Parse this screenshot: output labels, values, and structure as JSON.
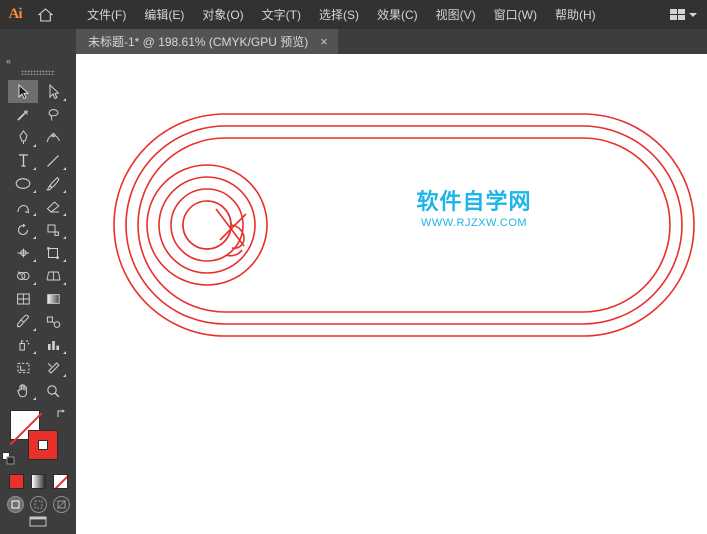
{
  "app": {
    "name": "Adobe Illustrator",
    "logo_text": "Ai",
    "home_icon": "home-icon"
  },
  "menubar": {
    "items": [
      {
        "label": "文件(F)",
        "name": "menu-file"
      },
      {
        "label": "编辑(E)",
        "name": "menu-edit"
      },
      {
        "label": "对象(O)",
        "name": "menu-object"
      },
      {
        "label": "文字(T)",
        "name": "menu-type"
      },
      {
        "label": "选择(S)",
        "name": "menu-select"
      },
      {
        "label": "效果(C)",
        "name": "menu-effect"
      },
      {
        "label": "视图(V)",
        "name": "menu-view"
      },
      {
        "label": "窗口(W)",
        "name": "menu-window"
      },
      {
        "label": "帮助(H)",
        "name": "menu-help"
      }
    ],
    "arrange_icon": "grid-arrange-icon",
    "arrange_caret": "chevron-down-icon"
  },
  "tabs": [
    {
      "title": "未标题-1* @ 198.61% (CMYK/GPU 预览)",
      "close_label": "×",
      "active": true
    }
  ],
  "toolbar": {
    "collapse_label": "«",
    "tools": [
      {
        "name": "selection-tool",
        "label": "选择工具",
        "selected": true
      },
      {
        "name": "direct-selection-tool",
        "label": "直接选择工具",
        "selected": false
      },
      {
        "name": "magic-wand-tool",
        "label": "魔棒工具",
        "selected": false
      },
      {
        "name": "lasso-tool",
        "label": "套索工具",
        "selected": false
      },
      {
        "name": "pen-tool",
        "label": "钢笔工具",
        "selected": false
      },
      {
        "name": "curvature-tool",
        "label": "曲率工具",
        "selected": false
      },
      {
        "name": "type-tool",
        "label": "文字工具",
        "selected": false
      },
      {
        "name": "line-segment-tool",
        "label": "直线段工具",
        "selected": false
      },
      {
        "name": "ellipse-tool",
        "label": "椭圆工具",
        "selected": false
      },
      {
        "name": "paintbrush-tool",
        "label": "画笔工具",
        "selected": false
      },
      {
        "name": "shaper-tool",
        "label": "Shaper 工具",
        "selected": false
      },
      {
        "name": "eraser-tool",
        "label": "橡皮擦工具",
        "selected": false
      },
      {
        "name": "rotate-tool",
        "label": "旋转工具",
        "selected": false
      },
      {
        "name": "scale-tool",
        "label": "比例缩放工具",
        "selected": false
      },
      {
        "name": "width-tool",
        "label": "宽度工具",
        "selected": false
      },
      {
        "name": "free-transform-tool",
        "label": "自由变换工具",
        "selected": false
      },
      {
        "name": "shape-builder-tool",
        "label": "形状生成器工具",
        "selected": false
      },
      {
        "name": "perspective-grid-tool",
        "label": "透视网格工具",
        "selected": false
      },
      {
        "name": "mesh-tool",
        "label": "网格工具",
        "selected": false
      },
      {
        "name": "gradient-tool",
        "label": "渐变工具",
        "selected": false
      },
      {
        "name": "eyedropper-tool",
        "label": "吸管工具",
        "selected": false
      },
      {
        "name": "blend-tool",
        "label": "混合工具",
        "selected": false
      },
      {
        "name": "symbol-sprayer-tool",
        "label": "符号喷枪工具",
        "selected": false
      },
      {
        "name": "column-graph-tool",
        "label": "柱形图工具",
        "selected": false
      },
      {
        "name": "artboard-tool",
        "label": "画板工具",
        "selected": false
      },
      {
        "name": "slice-tool",
        "label": "切片工具",
        "selected": false
      },
      {
        "name": "hand-tool",
        "label": "抓手工具",
        "selected": false
      },
      {
        "name": "zoom-tool",
        "label": "缩放工具",
        "selected": false
      }
    ],
    "colors": {
      "stroke_color": "#ffffff",
      "stroke_none": true,
      "fill_color": "#e8312a",
      "swap_icon": "swap-fill-stroke-icon",
      "default_icon": "default-fill-stroke-icon"
    },
    "color_modes": [
      {
        "name": "color-mode-color",
        "label": "颜色"
      },
      {
        "name": "color-mode-gradient",
        "label": "渐变"
      },
      {
        "name": "color-mode-none",
        "label": "无"
      }
    ],
    "draw_modes": [
      {
        "name": "draw-normal-mode",
        "label": "正常绘图",
        "active": true
      },
      {
        "name": "draw-behind-mode",
        "label": "背面绘图",
        "active": false
      },
      {
        "name": "draw-inside-mode",
        "label": "内部绘图",
        "active": false
      }
    ],
    "screen_mode_icon": "change-screen-mode-icon"
  },
  "canvas": {
    "watermark_title": "软件自学网",
    "watermark_url": "WWW.RJZXW.COM",
    "watermark_color": "#1fb5e8",
    "artwork_stroke_color": "#e8302a",
    "background": "#ffffff",
    "zoom_level": "198.61%"
  }
}
